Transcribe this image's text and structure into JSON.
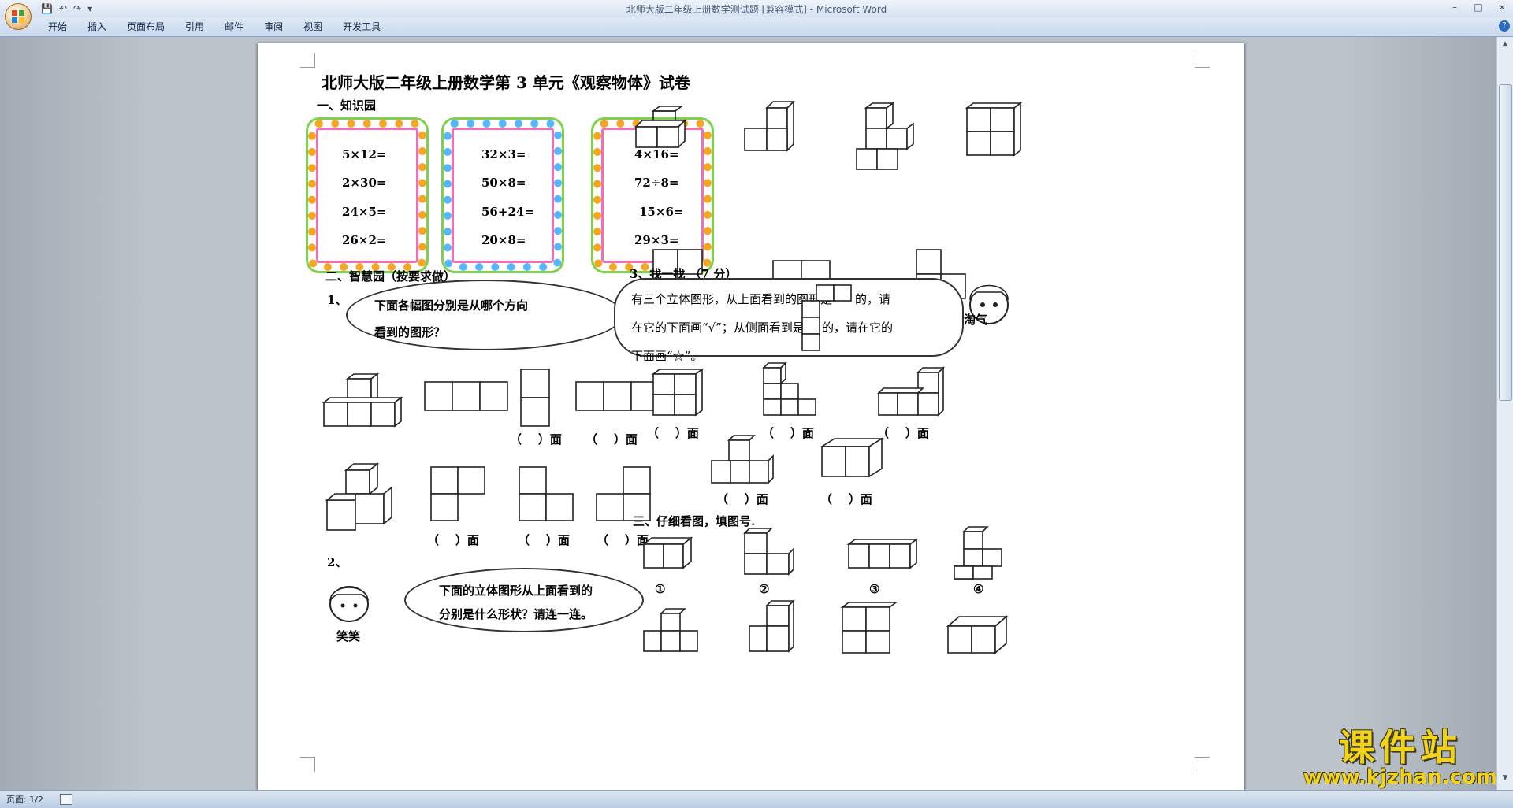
{
  "window": {
    "title": "北师大版二年级上册数学测试题 [兼容模式] - Microsoft Word",
    "qat_icons": [
      "save-icon",
      "undo-icon",
      "redo-icon",
      "customize-icon"
    ],
    "tabs": [
      "开始",
      "插入",
      "页面布局",
      "引用",
      "邮件",
      "审阅",
      "视图",
      "开发工具"
    ],
    "controls": [
      "–",
      "□",
      "×"
    ]
  },
  "status": {
    "page": "页面: 1/2"
  },
  "doc": {
    "title": "北师大版二年级上册数学第 3 单元《观察物体》试卷",
    "section1": "一、知识园",
    "eq_groups": [
      [
        "5×12=",
        "2×30=",
        "24×5=",
        "26×2="
      ],
      [
        "32×3=",
        "50×8=",
        "56+24=",
        "20×8="
      ],
      [
        "4×16=",
        "72÷8=",
        "15×6=",
        "29×3="
      ]
    ],
    "section2": "二、智慧园（按要求做）",
    "q1_label": "1、",
    "cloud1": [
      "下面各幅图分别是从哪个方向",
      "看到的图形？"
    ],
    "paren_face": "（    ）面",
    "q2_label": "2、",
    "cloud2": [
      "下面的立体图形从上面看到的",
      "分别是什么形状？请连一连。"
    ],
    "girl_label": "笑笑",
    "section3": "3、找一找 （7 分）",
    "bubble3": [
      "有三个立体图形，从上面看到的图形是",
      "的，请",
      "在它的下面画“√”；从侧面看到是",
      "的，请在它的",
      "下面画“☆”。"
    ],
    "boy_label": "淘气",
    "section_final": "三、仔细看图，填图号.",
    "circled": [
      "①",
      "②",
      "③",
      "④"
    ],
    "mark": "↵"
  },
  "watermark": {
    "name": "课件站",
    "url": "www.kjzhan.com"
  }
}
